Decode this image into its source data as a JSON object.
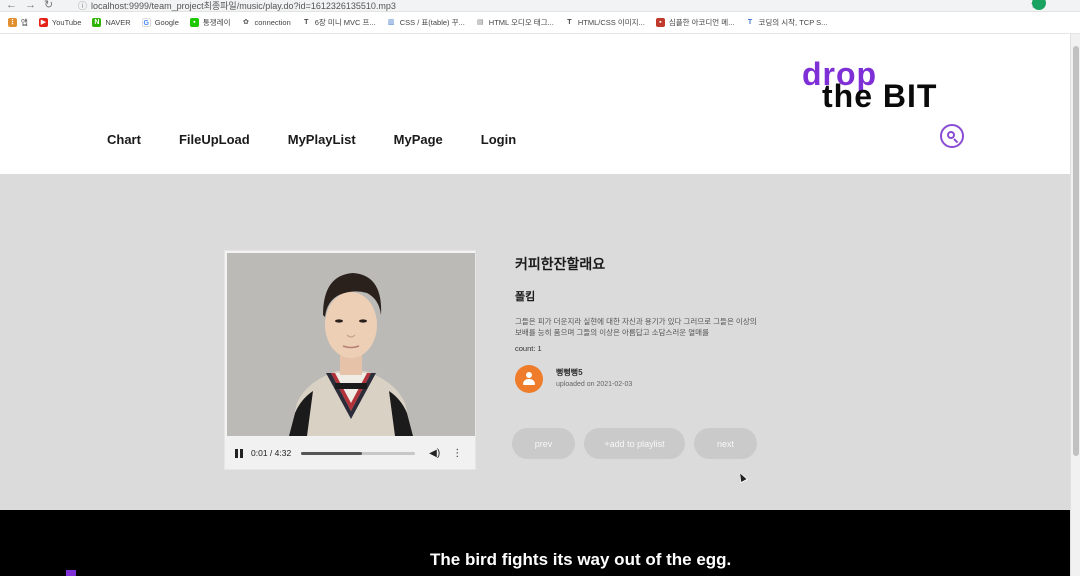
{
  "browser": {
    "url": "localhost:9999/team_project최종파일/music/play.do?id=1612326135510.mp3",
    "bookmarks": [
      {
        "label": "앱",
        "icon": "apps-grid-icon",
        "color": "#e0902e"
      },
      {
        "label": "YouTube",
        "icon": "youtube-icon",
        "color": "#e62117"
      },
      {
        "label": "NAVER",
        "icon": "naver-icon",
        "color": "#2db400"
      },
      {
        "label": "Google",
        "icon": "google-icon",
        "color": "#4285f4"
      },
      {
        "label": "통쟁레이",
        "icon": "bookmark-green-icon",
        "color": "#1ec800"
      },
      {
        "label": "connection",
        "icon": "paw-icon",
        "color": "#555555"
      },
      {
        "label": "6장 미니 MVC 프...",
        "icon": "t-icon",
        "color": "#444444"
      },
      {
        "label": "CSS / 표(table) 꾸...",
        "icon": "css-bars-icon",
        "color": "#3b73c8"
      },
      {
        "label": "HTML 오디오 태그...",
        "icon": "folder-icon",
        "color": "#777777"
      },
      {
        "label": "HTML/CSS 이미지...",
        "icon": "t-icon",
        "color": "#444444"
      },
      {
        "label": "심플한 아코디언 메...",
        "icon": "bookmark-red-icon",
        "color": "#c0392b"
      },
      {
        "label": "코딩의 시작, TCP S...",
        "icon": "t-blue-icon",
        "color": "#3b73c8"
      }
    ]
  },
  "logo": {
    "drop": "drop",
    "bit": "the BIT"
  },
  "nav": {
    "chart": "Chart",
    "upload": "FileUpLoad",
    "playlist": "MyPlayList",
    "mypage": "MyPage",
    "login": "Login"
  },
  "colors": {
    "brand_purple": "#7e2fd6",
    "avatar_orange": "#ee7c2b",
    "footer_bg": "#000000",
    "main_bg": "#dcdbdb"
  },
  "player": {
    "time": "0:01 / 4:32",
    "progress": 0.53
  },
  "song": {
    "title": "커피한잔할래요",
    "artist": "폴킴",
    "description": "그들은 피가 더운지라 실현에 대한 자신과 용기가 있다 그러므로 그들은 이상의 보배를 능히 품으며 그들의 이상은 아름답고 소담스러운 열매를",
    "count": "count: 1"
  },
  "uploader": {
    "name": "뻥뻥뻥5",
    "date": "uploaded on 2021-02-03"
  },
  "actions": {
    "prev": "prev",
    "add": "+add to playlist",
    "next": "next"
  },
  "footer": {
    "quote": "The bird fights its way out of the egg."
  }
}
